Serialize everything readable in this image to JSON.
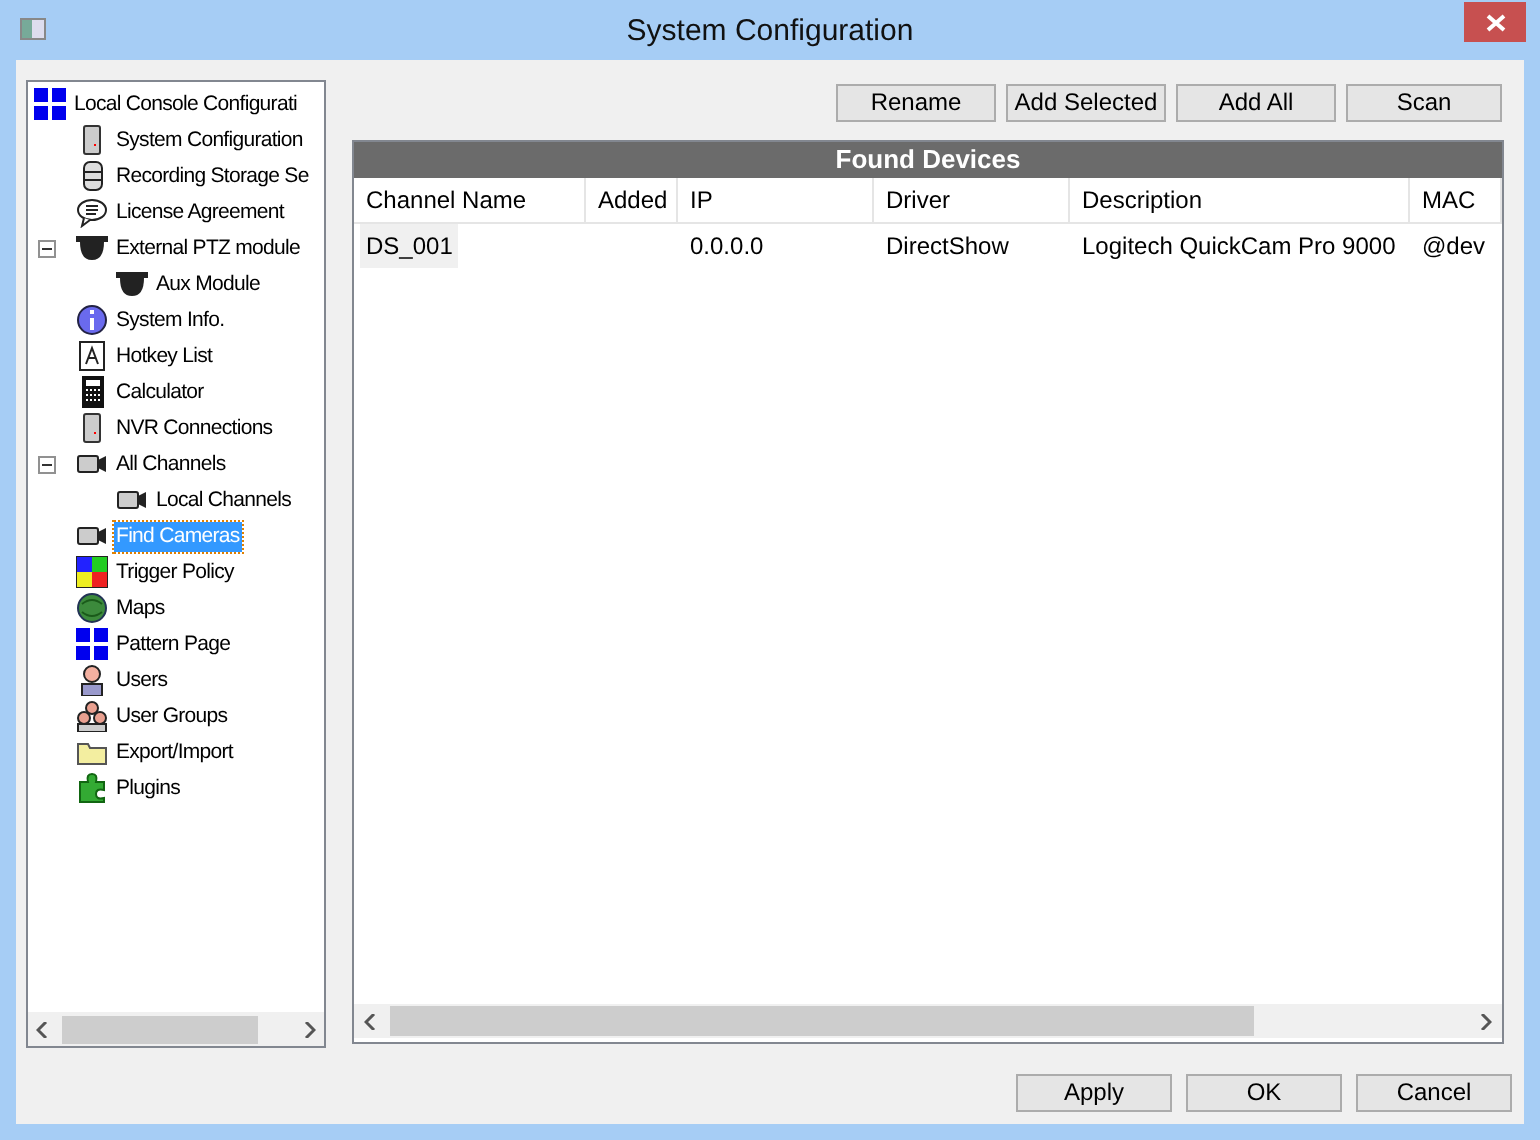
{
  "window": {
    "title": "System Configuration"
  },
  "tree": {
    "label": "Local Console Configurati",
    "children": [
      {
        "label": "System Configuration",
        "selected": false
      },
      {
        "label": "Recording Storage Se",
        "selected": false
      },
      {
        "label": "License Agreement",
        "selected": false
      },
      {
        "label": "External PTZ module",
        "selected": false,
        "expanded": true,
        "children": [
          {
            "label": "Aux Module",
            "selected": false
          }
        ]
      },
      {
        "label": "System Info.",
        "selected": false
      },
      {
        "label": "Hotkey List",
        "selected": false
      },
      {
        "label": "Calculator",
        "selected": false
      },
      {
        "label": "NVR Connections",
        "selected": false
      },
      {
        "label": "All Channels",
        "selected": false,
        "expanded": true,
        "children": [
          {
            "label": "Local Channels",
            "selected": false
          }
        ]
      },
      {
        "label": "Find Cameras",
        "selected": true
      },
      {
        "label": "Trigger Policy",
        "selected": false
      },
      {
        "label": "Maps",
        "selected": false
      },
      {
        "label": "Pattern Page",
        "selected": false
      },
      {
        "label": "Users",
        "selected": false
      },
      {
        "label": "User Groups",
        "selected": false
      },
      {
        "label": "Export/Import",
        "selected": false
      },
      {
        "label": "Plugins",
        "selected": false
      }
    ]
  },
  "toolbar": [
    "Rename",
    "Add Selected",
    "Add All",
    "Scan"
  ],
  "table": {
    "title": "Found Devices",
    "columns": [
      "Channel Name",
      "Added",
      "IP",
      "Driver",
      "Description",
      "MAC"
    ],
    "rows": [
      {
        "selected": true,
        "channel_name": "DS_001",
        "ip": "0.0.0.0",
        "driver": "DirectShow",
        "description": "Logitech QuickCam Pro 9000",
        "mac": "@dev"
      }
    ]
  },
  "buttons": [
    "Apply",
    "OK",
    "Cancel"
  ]
}
